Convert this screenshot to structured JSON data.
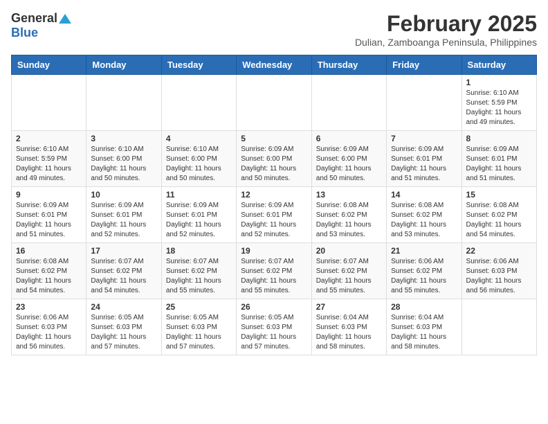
{
  "logo": {
    "general": "General",
    "blue": "Blue"
  },
  "title": "February 2025",
  "subtitle": "Dulian, Zamboanga Peninsula, Philippines",
  "weekdays": [
    "Sunday",
    "Monday",
    "Tuesday",
    "Wednesday",
    "Thursday",
    "Friday",
    "Saturday"
  ],
  "weeks": [
    [
      {
        "day": "",
        "info": ""
      },
      {
        "day": "",
        "info": ""
      },
      {
        "day": "",
        "info": ""
      },
      {
        "day": "",
        "info": ""
      },
      {
        "day": "",
        "info": ""
      },
      {
        "day": "",
        "info": ""
      },
      {
        "day": "1",
        "info": "Sunrise: 6:10 AM\nSunset: 5:59 PM\nDaylight: 11 hours\nand 49 minutes."
      }
    ],
    [
      {
        "day": "2",
        "info": "Sunrise: 6:10 AM\nSunset: 5:59 PM\nDaylight: 11 hours\nand 49 minutes."
      },
      {
        "day": "3",
        "info": "Sunrise: 6:10 AM\nSunset: 6:00 PM\nDaylight: 11 hours\nand 50 minutes."
      },
      {
        "day": "4",
        "info": "Sunrise: 6:10 AM\nSunset: 6:00 PM\nDaylight: 11 hours\nand 50 minutes."
      },
      {
        "day": "5",
        "info": "Sunrise: 6:09 AM\nSunset: 6:00 PM\nDaylight: 11 hours\nand 50 minutes."
      },
      {
        "day": "6",
        "info": "Sunrise: 6:09 AM\nSunset: 6:00 PM\nDaylight: 11 hours\nand 50 minutes."
      },
      {
        "day": "7",
        "info": "Sunrise: 6:09 AM\nSunset: 6:01 PM\nDaylight: 11 hours\nand 51 minutes."
      },
      {
        "day": "8",
        "info": "Sunrise: 6:09 AM\nSunset: 6:01 PM\nDaylight: 11 hours\nand 51 minutes."
      }
    ],
    [
      {
        "day": "9",
        "info": "Sunrise: 6:09 AM\nSunset: 6:01 PM\nDaylight: 11 hours\nand 51 minutes."
      },
      {
        "day": "10",
        "info": "Sunrise: 6:09 AM\nSunset: 6:01 PM\nDaylight: 11 hours\nand 52 minutes."
      },
      {
        "day": "11",
        "info": "Sunrise: 6:09 AM\nSunset: 6:01 PM\nDaylight: 11 hours\nand 52 minutes."
      },
      {
        "day": "12",
        "info": "Sunrise: 6:09 AM\nSunset: 6:01 PM\nDaylight: 11 hours\nand 52 minutes."
      },
      {
        "day": "13",
        "info": "Sunrise: 6:08 AM\nSunset: 6:02 PM\nDaylight: 11 hours\nand 53 minutes."
      },
      {
        "day": "14",
        "info": "Sunrise: 6:08 AM\nSunset: 6:02 PM\nDaylight: 11 hours\nand 53 minutes."
      },
      {
        "day": "15",
        "info": "Sunrise: 6:08 AM\nSunset: 6:02 PM\nDaylight: 11 hours\nand 54 minutes."
      }
    ],
    [
      {
        "day": "16",
        "info": "Sunrise: 6:08 AM\nSunset: 6:02 PM\nDaylight: 11 hours\nand 54 minutes."
      },
      {
        "day": "17",
        "info": "Sunrise: 6:07 AM\nSunset: 6:02 PM\nDaylight: 11 hours\nand 54 minutes."
      },
      {
        "day": "18",
        "info": "Sunrise: 6:07 AM\nSunset: 6:02 PM\nDaylight: 11 hours\nand 55 minutes."
      },
      {
        "day": "19",
        "info": "Sunrise: 6:07 AM\nSunset: 6:02 PM\nDaylight: 11 hours\nand 55 minutes."
      },
      {
        "day": "20",
        "info": "Sunrise: 6:07 AM\nSunset: 6:02 PM\nDaylight: 11 hours\nand 55 minutes."
      },
      {
        "day": "21",
        "info": "Sunrise: 6:06 AM\nSunset: 6:02 PM\nDaylight: 11 hours\nand 55 minutes."
      },
      {
        "day": "22",
        "info": "Sunrise: 6:06 AM\nSunset: 6:03 PM\nDaylight: 11 hours\nand 56 minutes."
      }
    ],
    [
      {
        "day": "23",
        "info": "Sunrise: 6:06 AM\nSunset: 6:03 PM\nDaylight: 11 hours\nand 56 minutes."
      },
      {
        "day": "24",
        "info": "Sunrise: 6:05 AM\nSunset: 6:03 PM\nDaylight: 11 hours\nand 57 minutes."
      },
      {
        "day": "25",
        "info": "Sunrise: 6:05 AM\nSunset: 6:03 PM\nDaylight: 11 hours\nand 57 minutes."
      },
      {
        "day": "26",
        "info": "Sunrise: 6:05 AM\nSunset: 6:03 PM\nDaylight: 11 hours\nand 57 minutes."
      },
      {
        "day": "27",
        "info": "Sunrise: 6:04 AM\nSunset: 6:03 PM\nDaylight: 11 hours\nand 58 minutes."
      },
      {
        "day": "28",
        "info": "Sunrise: 6:04 AM\nSunset: 6:03 PM\nDaylight: 11 hours\nand 58 minutes."
      },
      {
        "day": "",
        "info": ""
      }
    ]
  ]
}
